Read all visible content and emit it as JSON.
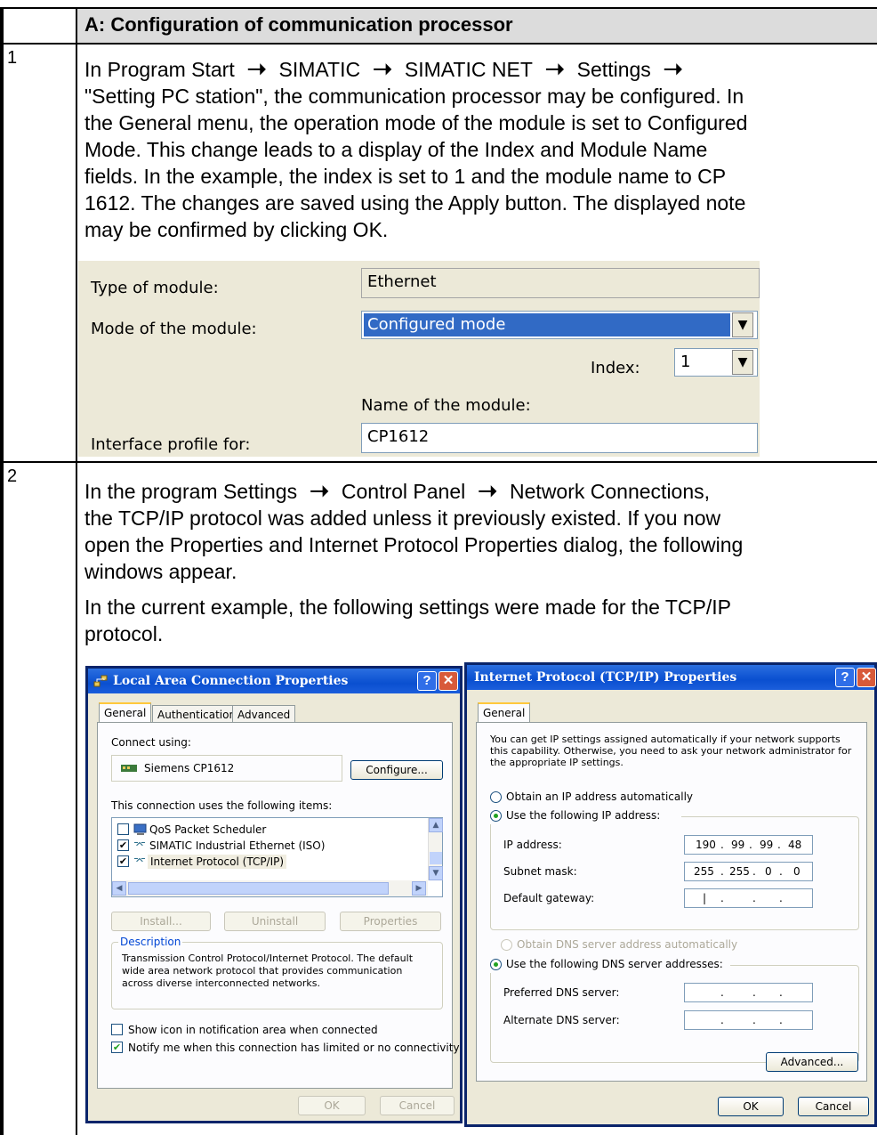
{
  "header": {
    "title": "A: Configuration of communication processor"
  },
  "rows": [
    {
      "num": "1",
      "prefix": "In Program Start",
      "path": [
        "SIMATIC",
        "SIMATIC NET",
        "Settings"
      ],
      "lines": [
        "\"Setting PC station\", the communication processor may be configured. In",
        "the General menu, the operation mode of the module is set to Configured",
        "Mode. This change leads to a display of the Index and Module Name",
        "fields. In the example, the index is set to 1 and the module name to CP",
        "1612. The changes are saved using the Apply button. The displayed note",
        "may be confirmed by clicking OK."
      ]
    },
    {
      "num": "2",
      "prefix": "In the program Settings",
      "path": [
        "Control Panel",
        "Network Connections,"
      ],
      "lines": [
        "the TCP/IP protocol was added unless it previously existed. If you now",
        "open the Properties and Internet Protocol Properties dialog, the following",
        "windows appear."
      ],
      "lines2": [
        "In the current example, the following settings were made for the TCP/IP",
        "protocol."
      ]
    }
  ],
  "config_panel": {
    "type_label": "Type of module:",
    "type_value": "Ethernet",
    "mode_label": "Mode of the module:",
    "mode_value": "Configured mode",
    "index_label": "Index:",
    "index_value": "1",
    "name_label": "Name of the module:",
    "interface_label": "Interface profile for:",
    "name_value": "CP1612"
  },
  "lan_dialog": {
    "title": "Local Area Connection Properties",
    "tabs": [
      "General",
      "Authentication",
      "Advanced"
    ],
    "connect_using": "Connect using:",
    "adapter": "Siemens CP1612",
    "configure": "Configure...",
    "items_label": "This connection uses the following items:",
    "items": [
      {
        "label": "QoS Packet Scheduler",
        "checked": false
      },
      {
        "label": "SIMATIC Industrial Ethernet (ISO)",
        "checked": true
      },
      {
        "label": "Internet Protocol (TCP/IP)",
        "checked": true
      }
    ],
    "install": "Install...",
    "uninstall": "Uninstall",
    "properties": "Properties",
    "description_label": "Description",
    "description_lines": [
      "Transmission Control Protocol/Internet Protocol. The default",
      "wide area network protocol that provides communication",
      "across diverse interconnected networks."
    ],
    "show_icon": "Show icon in notification area when connected",
    "notify": "Notify me when this connection has limited or no connectivity",
    "ok": "OK",
    "cancel": "Cancel"
  },
  "tcp_dialog": {
    "title": "Internet Protocol (TCP/IP) Properties",
    "tab": "General",
    "intro_lines": [
      "You can get IP settings assigned automatically if your network supports",
      "this capability. Otherwise, you need to ask your network administrator for",
      "the appropriate IP settings."
    ],
    "obtain_ip": "Obtain an IP address automatically",
    "use_ip": "Use the following IP address:",
    "ip_label": "IP address:",
    "ip": [
      "190",
      "99",
      "99",
      "48"
    ],
    "mask_label": "Subnet mask:",
    "mask": [
      "255",
      "255",
      "0",
      "0"
    ],
    "gateway_label": "Default gateway:",
    "obtain_dns": "Obtain DNS server address automatically",
    "use_dns": "Use the following DNS server addresses:",
    "pref_dns": "Preferred DNS server:",
    "alt_dns": "Alternate DNS server:",
    "advanced": "Advanced...",
    "ok": "OK",
    "cancel": "Cancel"
  },
  "colors": {
    "header_bg": "#dcdcdc",
    "xp_title": "#0a4fd0",
    "xp_face": "#ece9d8",
    "selection": "#316ac5"
  }
}
